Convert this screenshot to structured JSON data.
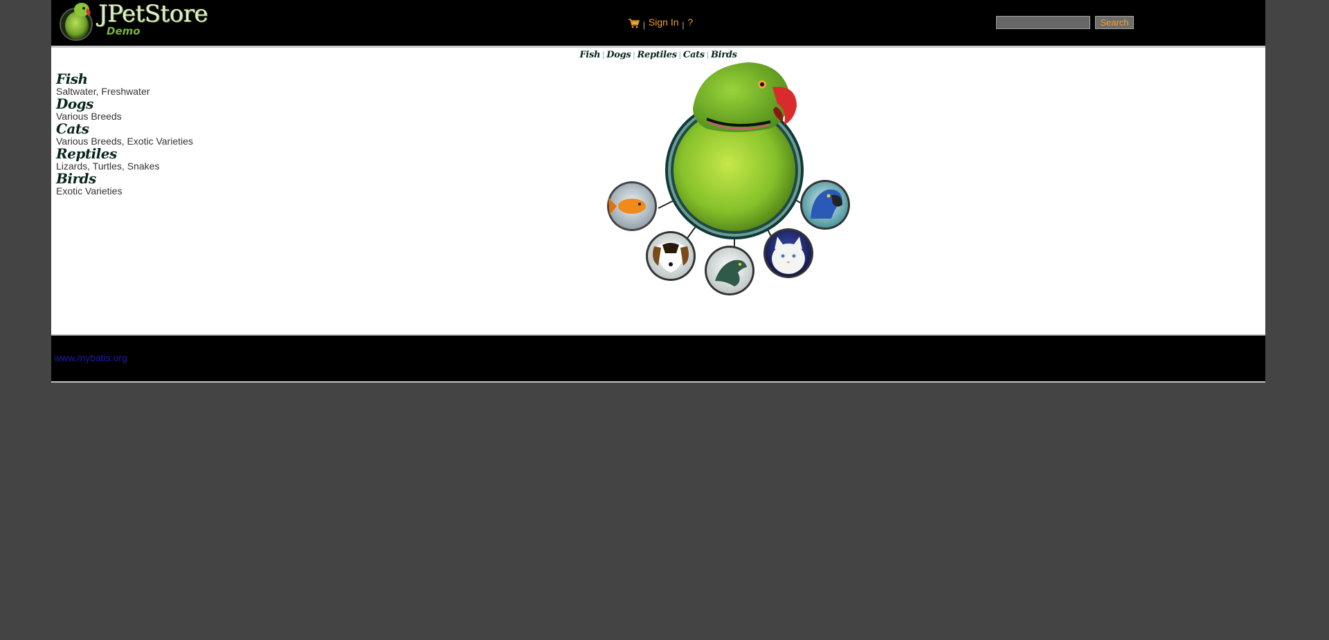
{
  "header": {
    "logo_text": "JPetStore",
    "logo_subtext": "Demo",
    "cart_icon": "shopping-cart-icon",
    "sign_in_label": "Sign In",
    "help_label": "?",
    "menu_separator": "|",
    "search_value": "",
    "search_button_label": "Search"
  },
  "quick_links": [
    "Fish",
    "Dogs",
    "Reptiles",
    "Cats",
    "Birds"
  ],
  "quick_link_separator": "|",
  "sidebar": {
    "items": [
      {
        "title": "Fish",
        "desc": "Saltwater, Freshwater"
      },
      {
        "title": "Dogs",
        "desc": "Various Breeds"
      },
      {
        "title": "Cats",
        "desc": "Various Breeds, Exotic Varieties"
      },
      {
        "title": "Reptiles",
        "desc": "Lizards, Turtles, Snakes"
      },
      {
        "title": "Birds",
        "desc": "Exotic Varieties"
      }
    ]
  },
  "footer": {
    "link_text": "www.mybatis.org"
  },
  "colors": {
    "page_bg": "#444444",
    "header_bg": "#000000",
    "link_orange": "#f0a32a",
    "footer_link": "#1b1ba8",
    "category_text": "#08251e"
  }
}
